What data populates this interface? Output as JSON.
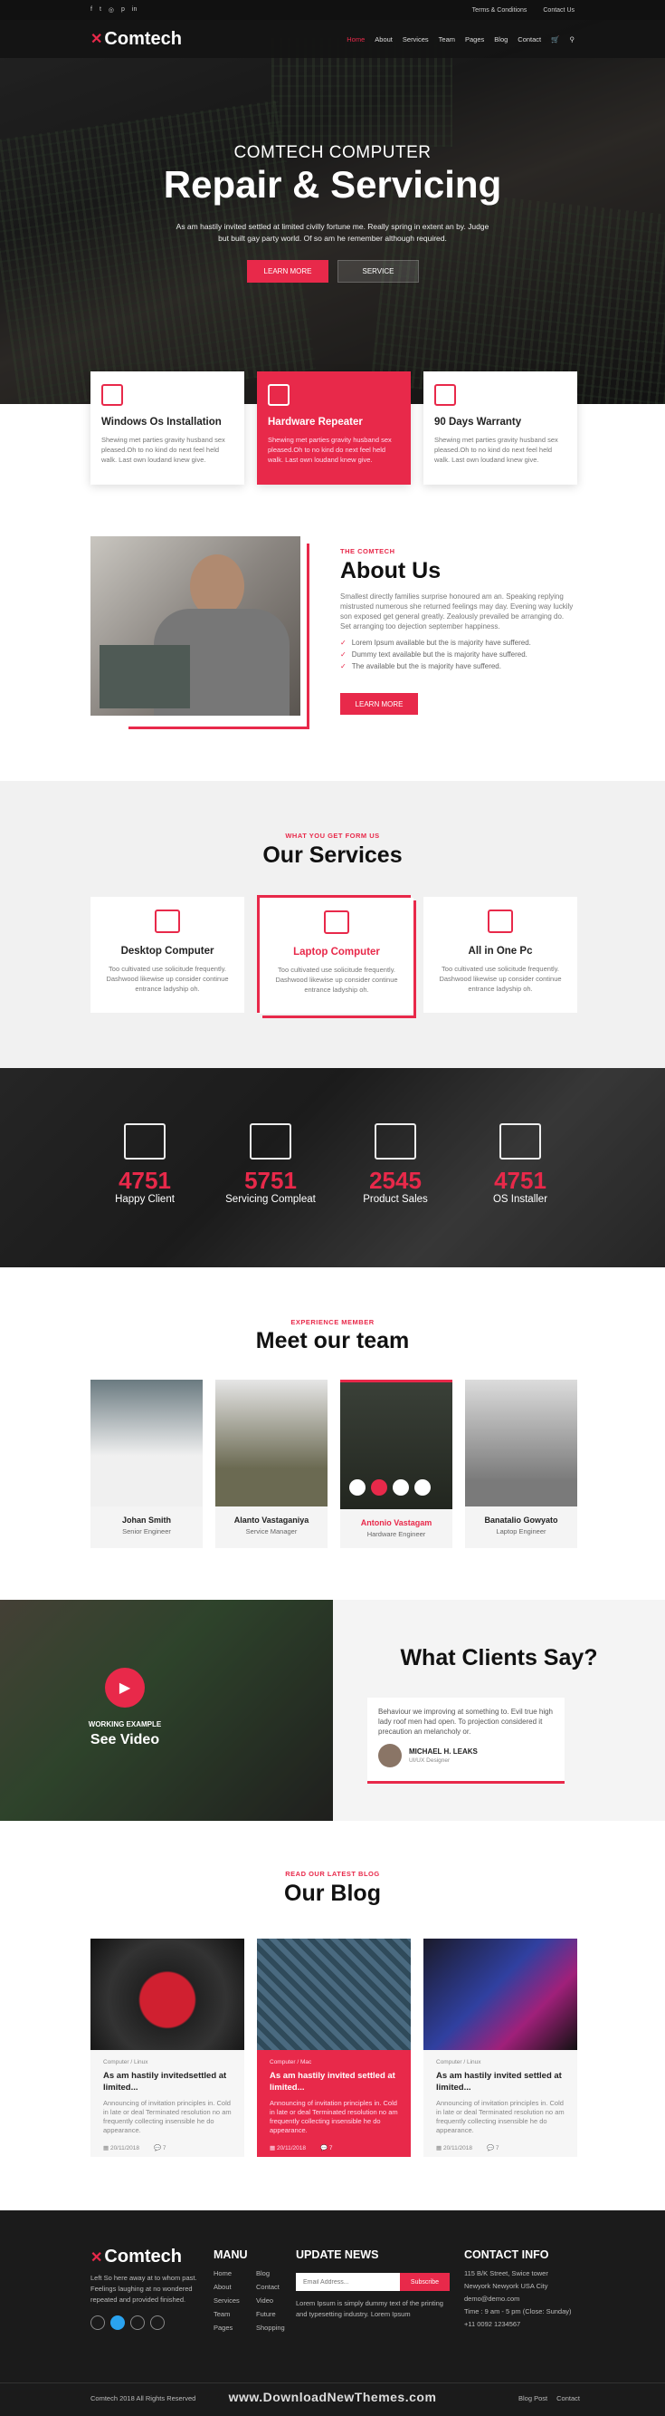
{
  "topbar": {
    "links": [
      "Terms & Conditions",
      "Contact Us"
    ]
  },
  "brand": {
    "name": "Comtech",
    "accent": "#e8294a"
  },
  "nav": {
    "items": [
      "Home",
      "About",
      "Services",
      "Team",
      "Pages",
      "Blog",
      "Contact"
    ]
  },
  "hero": {
    "subtitle": "COMTECH COMPUTER",
    "title": "Repair & Servicing",
    "text": "As am hastily invited settled at limited civilly fortune me. Really spring in extent an by. Judge but built gay party world. Of so am he remember although required.",
    "btn_primary": "LEARN MORE",
    "btn_secondary": "SERVICE"
  },
  "features": [
    {
      "title": "Windows Os Installation",
      "text": "Shewing met parties gravity husband sex pleased.Oh to no kind do next feel held walk. Last own loudand knew give."
    },
    {
      "title": "Hardware Repeater",
      "text": "Shewing met parties gravity husband sex pleased.Oh to no kind do next feel held walk. Last own loudand knew give."
    },
    {
      "title": "90 Days Warranty",
      "text": "Shewing met parties gravity husband sex pleased.Oh to no kind do next feel held walk. Last own loudand knew give."
    }
  ],
  "about": {
    "eyebrow": "THE COMTECH",
    "title": "About Us",
    "text": "Smallest directly families surprise honoured am an. Speaking replying mistrusted numerous she returned feelings may day. Evening way luckily son exposed get general greatly. Zealously prevailed be arranging do. Set arranging too dejection september happiness.",
    "checks": [
      "Lorem Ipsum available but the is majority have suffered.",
      "Dummy text available but the is majority have suffered.",
      "The available but the is majority have suffered."
    ],
    "btn": "LEARN MORE"
  },
  "services": {
    "eyebrow": "WHAT YOU GET FORM US",
    "title": "Our Services",
    "items": [
      {
        "title": "Desktop Computer",
        "text": "Too cultivated use solicitude frequently. Dashwood likewise up consider continue entrance ladyship oh."
      },
      {
        "title": "Laptop Computer",
        "text": "Too cultivated use solicitude frequently. Dashwood likewise up consider continue entrance ladyship oh."
      },
      {
        "title": "All in One Pc",
        "text": "Too cultivated use solicitude frequently. Dashwood likewise up consider continue entrance ladyship oh."
      }
    ]
  },
  "counters": [
    {
      "num": "4751",
      "label": "Happy Client"
    },
    {
      "num": "5751",
      "label": "Servicing Compleat"
    },
    {
      "num": "2545",
      "label": "Product Sales"
    },
    {
      "num": "4751",
      "label": "OS Installer"
    }
  ],
  "team": {
    "eyebrow": "EXPERIENCE MEMBER",
    "title": "Meet our team",
    "members": [
      {
        "name": "Johan Smith",
        "role": "Senior Engineer"
      },
      {
        "name": "Alanto Vastaganiya",
        "role": "Service Manager"
      },
      {
        "name": "Antonio Vastagam",
        "role": "Hardware Engineer"
      },
      {
        "name": "Banatalio Gowyato",
        "role": "Laptop Engineer"
      }
    ]
  },
  "testimonial": {
    "video_eyebrow": "WORKING EXAMPLE",
    "video_title": "See Video",
    "title": "What Clients Say?",
    "quote": "Behaviour we improving at something to. Evil true high lady roof men had open. To projection considered it precaution an melancholy or.",
    "author": "MICHAEL H. LEAKS",
    "author_role": "UI/UX Designer"
  },
  "blog": {
    "eyebrow": "READ OUR LATEST BLOG",
    "title": "Our Blog",
    "posts": [
      {
        "cat": "Computer / Linux",
        "title": "As am hastily invitedsettled at limited...",
        "text": "Announcing of invitation principles in. Cold in late or deal Terminated resolution no am frequently collecting insensible he do appearance.",
        "date": "20/11/2018",
        "comments": "7"
      },
      {
        "cat": "Computer / Mac",
        "title": "As am hastily invited settled at limited...",
        "text": "Announcing of invitation principles in. Cold in late or deal Terminated resolution no am frequently collecting insensible he do appearance.",
        "date": "20/11/2018",
        "comments": "7"
      },
      {
        "cat": "Computer / Linux",
        "title": "As am hastily invited settled at limited...",
        "text": "Announcing of invitation principles in. Cold in late or deal Terminated resolution no am frequently collecting insensible he do appearance.",
        "date": "20/11/2018",
        "comments": "7"
      }
    ]
  },
  "footer": {
    "about": "Left So here away at to whom past. Feelings laughing at no wondered repeated and provided finished.",
    "menu_title": "MANU",
    "menu_col1": [
      "Home",
      "About",
      "Services",
      "Team",
      "Pages"
    ],
    "menu_col2": [
      "Blog",
      "Contact",
      "Video",
      "Future",
      "Shopping"
    ],
    "update_title": "UPDATE NEWS",
    "email_placeholder": "Email Address...",
    "subscribe": "Subscribe",
    "update_text": "Lorem Ipsum is simply dummy text of the printing and typesetting industry. Lorem Ipsum",
    "contact_title": "CONTACT INFO",
    "contact_lines": [
      "115 B/K Street, Swice tower",
      "Newyork Newyork USA City",
      "demo@demo.com",
      "Time : 9 am - 5 pm (Close: Sunday)",
      "+11 0092 1234567"
    ],
    "copyright": "Comtech 2018 All Rights Reserved",
    "watermark": "www.DownloadNewThemes.com",
    "bottom_links": [
      "Blog Post",
      "Contact"
    ]
  }
}
